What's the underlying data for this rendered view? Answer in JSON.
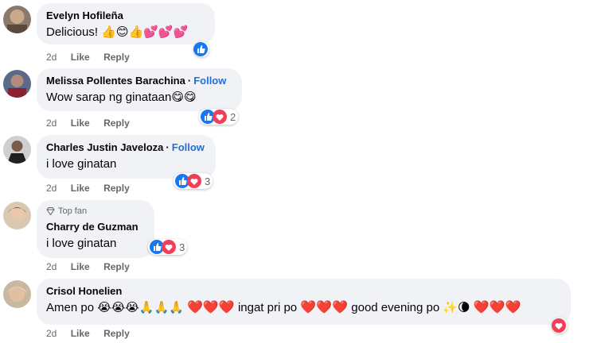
{
  "comments": [
    {
      "name": "Evelyn Hofileña",
      "follow": "",
      "text": "Delicious! 👍😊👍💕💕💕",
      "time": "2d",
      "like": "Like",
      "reply": "Reply",
      "reactions": [
        "like-icon"
      ],
      "count": ""
    },
    {
      "name": "Melissa Pollentes Barachina",
      "follow": "Follow",
      "text": "Wow sarap ng ginataan😋😋",
      "time": "2d",
      "like": "Like",
      "reply": "Reply",
      "reactions": [
        "like-icon",
        "love-icon"
      ],
      "count": "2"
    },
    {
      "name": "Charles Justin Javeloza",
      "follow": "Follow",
      "text": "i love ginatan",
      "time": "2d",
      "like": "Like",
      "reply": "Reply",
      "reactions": [
        "like-icon",
        "love-icon"
      ],
      "count": "3"
    },
    {
      "badge": "Top fan",
      "name": "Charry de Guzman",
      "follow": "",
      "text": "i love ginatan",
      "time": "2d",
      "like": "Like",
      "reply": "Reply",
      "reactions": [
        "like-icon",
        "love-icon"
      ],
      "count": "3"
    },
    {
      "name": "Crisol Honelien",
      "follow": "",
      "text_a": "Amen po 😭😭😭🙏🙏🙏",
      "text_b": "ingat pri po",
      "text_c": "good evening po ✨🌘",
      "hearts": "❤️❤️❤️",
      "time": "2d",
      "like": "Like",
      "reply": "Reply",
      "reactions": [
        "love-icon"
      ],
      "count": ""
    }
  ],
  "colors": {
    "like": "#1877f2",
    "love": "#f33e58",
    "follow": "#216fdb",
    "bubble": "#f0f2f5"
  }
}
